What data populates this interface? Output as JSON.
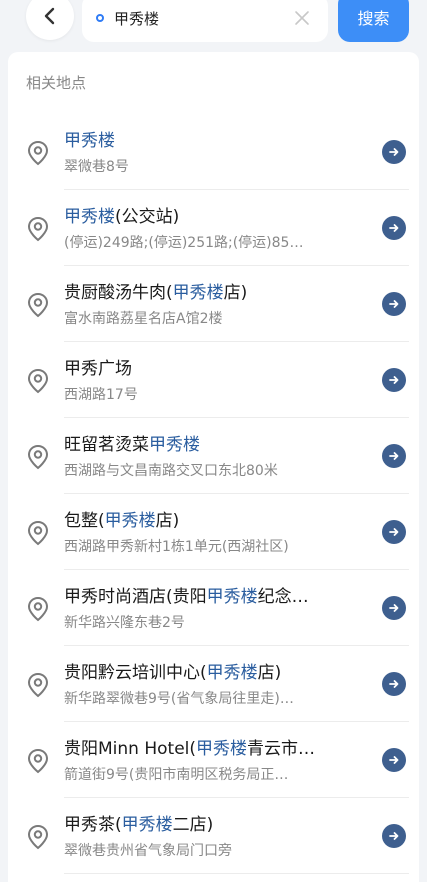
{
  "header": {
    "search_value": "甲秀楼",
    "search_button": "搜索"
  },
  "section_title": "相关地点",
  "items": [
    {
      "name_parts": [
        {
          "t": "甲秀楼",
          "h": true
        }
      ],
      "address": "翠微巷8号"
    },
    {
      "name_parts": [
        {
          "t": "甲秀楼",
          "h": true
        },
        {
          "t": "(公交站)",
          "h": false
        }
      ],
      "address": "(停运)249路;(停运)251路;(停运)85…"
    },
    {
      "name_parts": [
        {
          "t": "贵厨酸汤牛肉(",
          "h": false
        },
        {
          "t": "甲秀楼",
          "h": true
        },
        {
          "t": "店)",
          "h": false
        }
      ],
      "address": "富水南路荔星名店A馆2楼"
    },
    {
      "name_parts": [
        {
          "t": "甲秀广场",
          "h": false
        }
      ],
      "address": "西湖路17号"
    },
    {
      "name_parts": [
        {
          "t": "旺留茗烫菜",
          "h": false
        },
        {
          "t": "甲秀楼",
          "h": true
        }
      ],
      "address": "西湖路与文昌南路交叉口东北80米"
    },
    {
      "name_parts": [
        {
          "t": "包整(",
          "h": false
        },
        {
          "t": "甲秀楼",
          "h": true
        },
        {
          "t": "店)",
          "h": false
        }
      ],
      "address": "西湖路甲秀新村1栋1单元(西湖社区)"
    },
    {
      "name_parts": [
        {
          "t": "甲秀时尚酒店(贵阳",
          "h": false
        },
        {
          "t": "甲秀楼",
          "h": true
        },
        {
          "t": "纪念…",
          "h": false
        }
      ],
      "address": "新华路兴隆东巷2号"
    },
    {
      "name_parts": [
        {
          "t": "贵阳黔云培训中心(",
          "h": false
        },
        {
          "t": "甲秀楼",
          "h": true
        },
        {
          "t": "店)",
          "h": false
        }
      ],
      "address": "新华路翠微巷9号(省气象局往里走)…"
    },
    {
      "name_parts": [
        {
          "t": "贵阳Minn Hotel(",
          "h": false
        },
        {
          "t": "甲秀楼",
          "h": true
        },
        {
          "t": "青云市…",
          "h": false
        }
      ],
      "address": "箭道街9号(贵阳市南明区税务局正…"
    },
    {
      "name_parts": [
        {
          "t": "甲秀茶(",
          "h": false
        },
        {
          "t": "甲秀楼",
          "h": true
        },
        {
          "t": "二店)",
          "h": false
        }
      ],
      "address": "翠微巷贵州省气象局门口旁"
    }
  ],
  "colors": {
    "accent": "#3d8ef7",
    "highlight": "#2a5d9f",
    "go_button": "#3e5f8f"
  }
}
